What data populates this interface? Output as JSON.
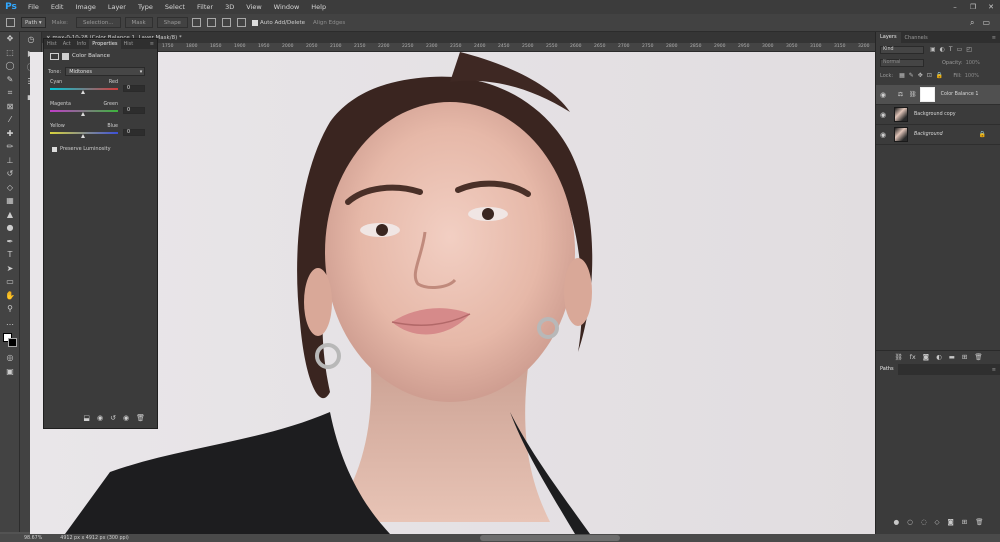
{
  "app": {
    "logo": "Ps",
    "menu": [
      "File",
      "Edit",
      "Image",
      "Layer",
      "Type",
      "Select",
      "Filter",
      "3D",
      "View",
      "Window",
      "Help"
    ],
    "window_controls": [
      "–",
      "❐",
      "✕"
    ]
  },
  "options_bar": {
    "tool_mode": "Path",
    "make_label": "Make:",
    "selection_btn": "Selection...",
    "mask_btn": "Mask",
    "shape_btn": "Shape",
    "auto_add_delete": "Auto Add/Delete",
    "align_edges": "Align Edges"
  },
  "document": {
    "tab_title": "× max-0-10-28 (Color Balance 1, Layer Mask/8) *",
    "ruler_marks": [
      "1750",
      "1800",
      "1850",
      "1900",
      "1950",
      "2000",
      "2050",
      "2100",
      "2150",
      "2200",
      "2250",
      "2300",
      "2350",
      "2400",
      "2450",
      "2500",
      "2550",
      "2600",
      "2650",
      "2700",
      "2750",
      "2800",
      "2850",
      "2900",
      "2950",
      "3000",
      "3050",
      "3100",
      "3150",
      "3200"
    ]
  },
  "properties": {
    "tabs": [
      "Hist",
      "Act",
      "Info",
      "Properties",
      "Hist"
    ],
    "active_tab": "Properties",
    "title": "Color Balance",
    "tone_label": "Tone:",
    "tone_value": "Midtones",
    "sliders": [
      {
        "left": "Cyan",
        "right": "Red",
        "value": "0",
        "track": "linear-gradient(90deg,#00c8d8,#d43c3c)"
      },
      {
        "left": "Magenta",
        "right": "Green",
        "value": "0",
        "track": "linear-gradient(90deg,#c03cc8,#3cb43c)"
      },
      {
        "left": "Yellow",
        "right": "Blue",
        "value": "0",
        "track": "linear-gradient(90deg,#d8d23c,#3c50d8)"
      }
    ],
    "preserve_label": "Preserve Luminosity"
  },
  "layers": {
    "tabs": [
      "Layers",
      "Channels"
    ],
    "kind_label": "Kind",
    "blend_mode": "Normal",
    "opacity_label": "Opacity:",
    "opacity_value": "100%",
    "lock_label": "Lock:",
    "fill_label": "Fill:",
    "fill_value": "100%",
    "items": [
      {
        "name": "Color Balance 1",
        "type": "adjustment"
      },
      {
        "name": "Background copy",
        "type": "image"
      },
      {
        "name": "Background",
        "type": "image"
      }
    ]
  },
  "paths": {
    "title": "Paths"
  },
  "status": {
    "zoom": "98.67%",
    "doc_info": "4912 px x 4912 px (300 ppi)"
  }
}
